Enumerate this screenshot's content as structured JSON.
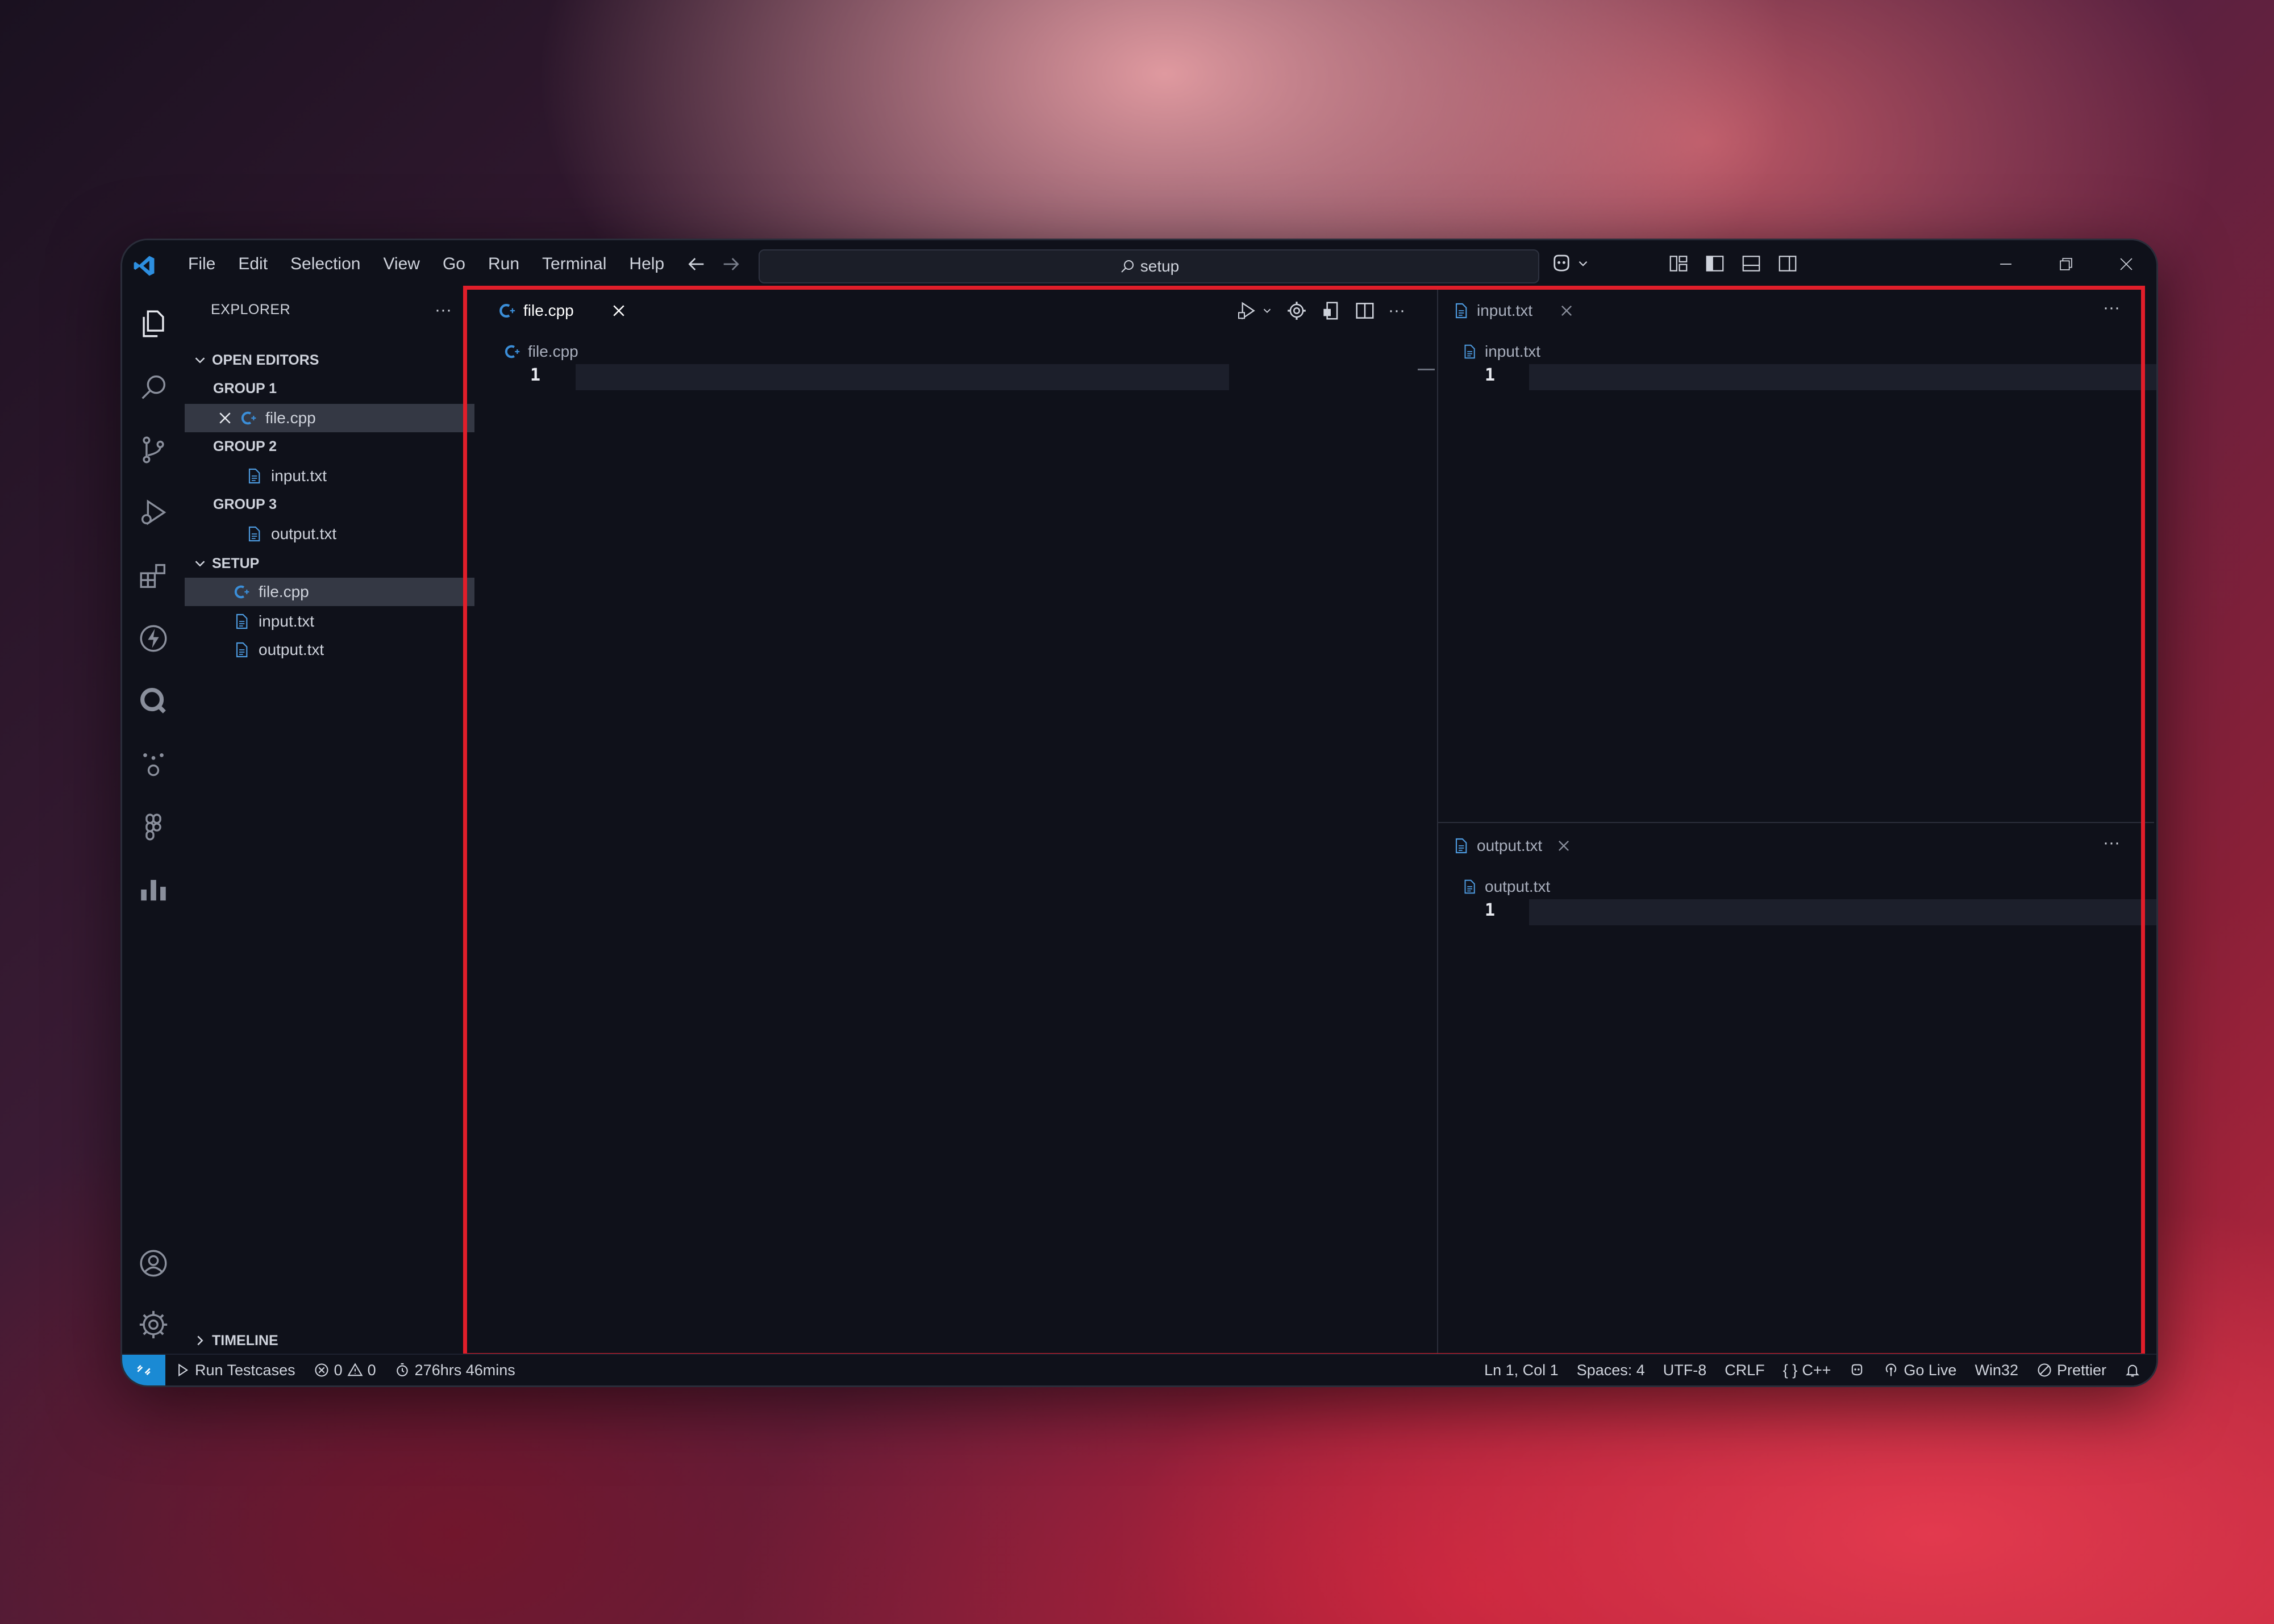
{
  "titlebar": {
    "menu": [
      "File",
      "Edit",
      "Selection",
      "View",
      "Go",
      "Run",
      "Terminal",
      "Help"
    ],
    "search_text": "setup"
  },
  "sidebar": {
    "title": "EXPLORER",
    "more": "···",
    "open_editors_label": "OPEN EDITORS",
    "groups": [
      {
        "label": "GROUP 1",
        "file": "file.cpp"
      },
      {
        "label": "GROUP 2",
        "file": "input.txt"
      },
      {
        "label": "GROUP 3",
        "file": "output.txt"
      }
    ],
    "folder_label": "SETUP",
    "files": [
      "file.cpp",
      "input.txt",
      "output.txt"
    ],
    "timeline_label": "TIMELINE"
  },
  "editor": {
    "left": {
      "tab": "file.cpp",
      "breadcrumb": "file.cpp",
      "line": "1"
    },
    "right_top": {
      "tab": "input.txt",
      "breadcrumb": "input.txt",
      "line": "1"
    },
    "right_bottom": {
      "tab": "output.txt",
      "breadcrumb": "output.txt",
      "line": "1"
    },
    "more": "···"
  },
  "statusbar": {
    "run_testcases": "Run Testcases",
    "errors": "0",
    "warnings": "0",
    "time": "276hrs 46mins",
    "position": "Ln 1, Col 1",
    "spaces": "Spaces: 4",
    "encoding": "UTF-8",
    "eol": "CRLF",
    "language": "C++",
    "language_prefix": "{ }",
    "go_live": "Go Live",
    "platform": "Win32",
    "prettier": "Prettier"
  },
  "colors": {
    "accent": "#1a8ad4",
    "highlight_border": "#e01e2a",
    "cpp_icon": "#3b8ed8",
    "txt_icon": "#4e9be0"
  }
}
